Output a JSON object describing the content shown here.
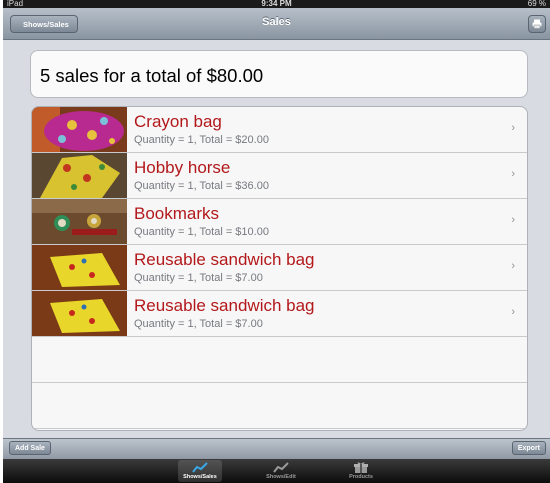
{
  "status_bar": {
    "carrier": "iPad",
    "time": "9:34 PM",
    "battery": "69 %"
  },
  "nav": {
    "back_label": "Shows/Sales",
    "title": "Sales",
    "right_icon": "print-icon"
  },
  "summary": {
    "text": "5 sales for a total of $80.00"
  },
  "sales": [
    {
      "name": "Crayon bag",
      "detail": "Quantity = 1, Total = $20.00"
    },
    {
      "name": "Hobby horse",
      "detail": "Quantity = 1, Total = $36.00"
    },
    {
      "name": "Bookmarks",
      "detail": "Quantity = 1, Total = $10.00"
    },
    {
      "name": "Reusable sandwich bag",
      "detail": "Quantity = 1, Total = $7.00"
    },
    {
      "name": "Reusable sandwich bag",
      "detail": "Quantity = 1, Total = $7.00"
    }
  ],
  "chevron": "›",
  "toolbar": {
    "add_label": "Add Sale",
    "export_label": "Export"
  },
  "tabs": [
    {
      "label": "Shows/Sales",
      "icon": "chart-icon",
      "selected": true
    },
    {
      "label": "Shows/Edit",
      "icon": "chart-icon",
      "selected": false
    },
    {
      "label": "Products",
      "icon": "gift-icon",
      "selected": false
    }
  ],
  "colors": {
    "accent_red": "#b3181b",
    "background": "#d8dbe1",
    "nav_bar": "#8a95a2"
  }
}
